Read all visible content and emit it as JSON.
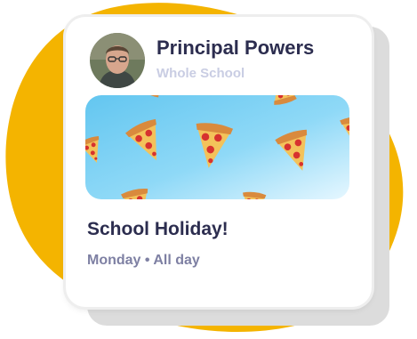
{
  "colors": {
    "background_blob": "#f4b400",
    "card": "#ffffff",
    "card_shadow": "#dcdcdc",
    "title_text": "#2c2d4f",
    "audience_text": "#c9cde3",
    "meta_text": "#7e80a3",
    "banner_sky": "#7fd3f5"
  },
  "post": {
    "author": {
      "name": "Principal Powers",
      "avatar_icon": "person-photo"
    },
    "audience": "Whole School",
    "banner_icon": "pizza-slice-pattern",
    "event": {
      "title": "School Holiday!",
      "when": "Monday • All day"
    }
  }
}
